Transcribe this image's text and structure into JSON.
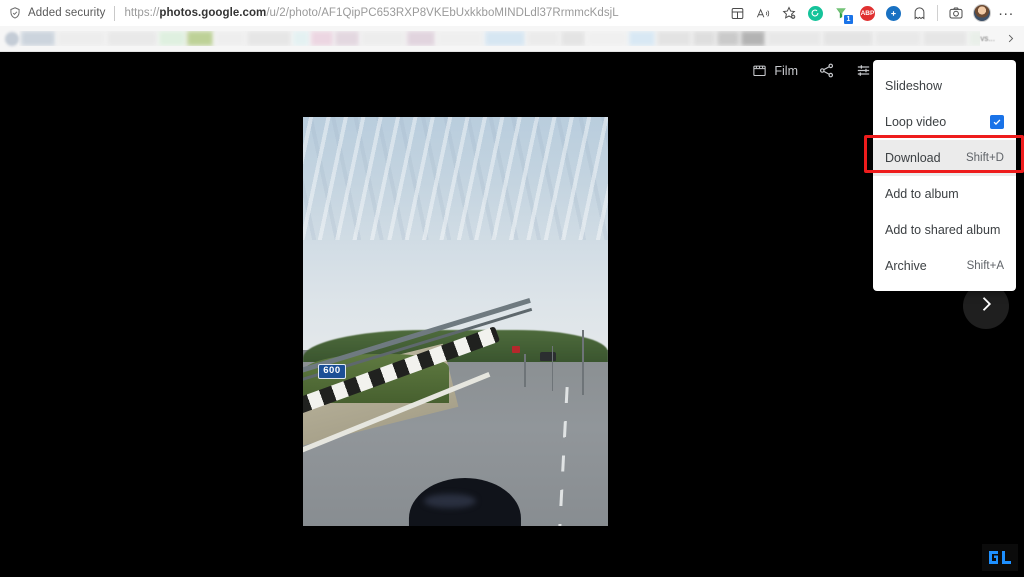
{
  "browser": {
    "security_badge": {
      "icon": "shield-icon",
      "label": "Added security"
    },
    "url": {
      "scheme": "https://",
      "domain": "photos.google.com",
      "path": "/u/2/photo/AF1QipPC653RXP8VKEbUxkkboMINDLdl37RrmmcKdsjL",
      "full": "https://photos.google.com/u/2/photo/AF1QipPC653RXP8VKEbUxkkboMINDLdl37RrmmcKdsjL"
    },
    "toolbar_icons": [
      {
        "name": "collections-icon",
        "glyph": "collections"
      },
      {
        "name": "read-aloud-icon",
        "glyph": "A-with-sound"
      },
      {
        "name": "add-favorite-icon",
        "glyph": "star-plus"
      },
      {
        "name": "extension-grammarly-icon",
        "color": "#15c39a"
      },
      {
        "name": "extension-download-manager-icon",
        "color": "#2f9e44",
        "badge": "1"
      },
      {
        "name": "extension-adblock-icon",
        "color": "#e03131",
        "label": "ABP"
      },
      {
        "name": "extension-blue-icon",
        "color": "#1971c2"
      },
      {
        "name": "extension-ghostery-icon",
        "color": "#4b4b4b"
      },
      {
        "name": "screenshot-icon",
        "glyph": "camera"
      },
      {
        "name": "avatar",
        "glyph": "profile-photo"
      },
      {
        "name": "browser-settings-more-icon",
        "glyph": "..."
      }
    ],
    "bookmarks_bar": {
      "overflow_label": "vs...",
      "overflow_icon": "chevron-right-icon",
      "chips": [
        {
          "w": 34,
          "color": "#ccd4dd"
        },
        {
          "w": 48,
          "color": "#ededed"
        },
        {
          "w": 50,
          "color": "#e9e9e9"
        },
        {
          "w": 26,
          "color": "#dff0e0"
        },
        {
          "w": 26,
          "color": "#bdd197"
        },
        {
          "w": 30,
          "color": "#eeeeee"
        },
        {
          "w": 44,
          "color": "#e6e6e6"
        },
        {
          "w": 16,
          "color": "#e4f1f2"
        },
        {
          "w": 22,
          "color": "#ecd6e2"
        },
        {
          "w": 24,
          "color": "#e3d7e0"
        },
        {
          "w": 44,
          "color": "#ededed"
        },
        {
          "w": 28,
          "color": "#e1d4de"
        },
        {
          "w": 46,
          "color": "#efefef"
        },
        {
          "w": 40,
          "color": "#d6e6f2"
        },
        {
          "w": 32,
          "color": "#ebebeb"
        },
        {
          "w": 24,
          "color": "#e4e4e4"
        },
        {
          "w": 40,
          "color": "#f0f0f0"
        },
        {
          "w": 26,
          "color": "#d8e8f4"
        },
        {
          "w": 34,
          "color": "#e3e3e3"
        },
        {
          "w": 22,
          "color": "#dedede"
        },
        {
          "w": 22,
          "color": "#cacaca"
        },
        {
          "w": 24,
          "color": "#b3b3b3"
        },
        {
          "w": 54,
          "color": "#e8e8e8"
        },
        {
          "w": 50,
          "color": "#e4e4e4"
        },
        {
          "w": 46,
          "color": "#e9e9e9"
        },
        {
          "w": 44,
          "color": "#e6e6e6"
        },
        {
          "w": 36,
          "color": "#e9efe9"
        },
        {
          "w": 40,
          "color": "#ececec"
        },
        {
          "w": 34,
          "color": "#e2e2e2"
        }
      ]
    }
  },
  "viewer": {
    "toolbar": [
      {
        "name": "film-button",
        "icon": "film-strip-icon",
        "label": "Film"
      },
      {
        "name": "share-button",
        "icon": "share-icon",
        "label": ""
      },
      {
        "name": "edit-button",
        "icon": "tune-sliders-icon",
        "label": ""
      }
    ],
    "next_button": {
      "name": "next-photo-button",
      "icon": "chevron-right-icon"
    },
    "photo": {
      "name": "photo-viewer-image",
      "description": "Motorcycle point-of-view on a highway with guardrail and kerb stripes",
      "milestone_marker": "600"
    },
    "watermark": {
      "name": "site-watermark",
      "text": "GT"
    }
  },
  "menu": {
    "name": "photo-options-menu",
    "items": [
      {
        "label": "Slideshow",
        "shortcut": "",
        "checkbox": false,
        "highlighted": false,
        "name": "menu-item-slideshow"
      },
      {
        "label": "Loop video",
        "shortcut": "",
        "checkbox": true,
        "highlighted": false,
        "name": "menu-item-loop-video"
      },
      {
        "label": "Download",
        "shortcut": "Shift+D",
        "checkbox": false,
        "highlighted": true,
        "name": "menu-item-download"
      },
      {
        "label": "Add to album",
        "shortcut": "",
        "checkbox": false,
        "highlighted": false,
        "name": "menu-item-add-to-album"
      },
      {
        "label": "Add to shared album",
        "shortcut": "",
        "checkbox": false,
        "highlighted": false,
        "name": "menu-item-add-to-shared-album"
      },
      {
        "label": "Archive",
        "shortcut": "Shift+A",
        "checkbox": false,
        "highlighted": false,
        "name": "menu-item-archive"
      }
    ],
    "highlight_color": "#ee1c1c",
    "checkbox_color": "#1a73e8"
  }
}
